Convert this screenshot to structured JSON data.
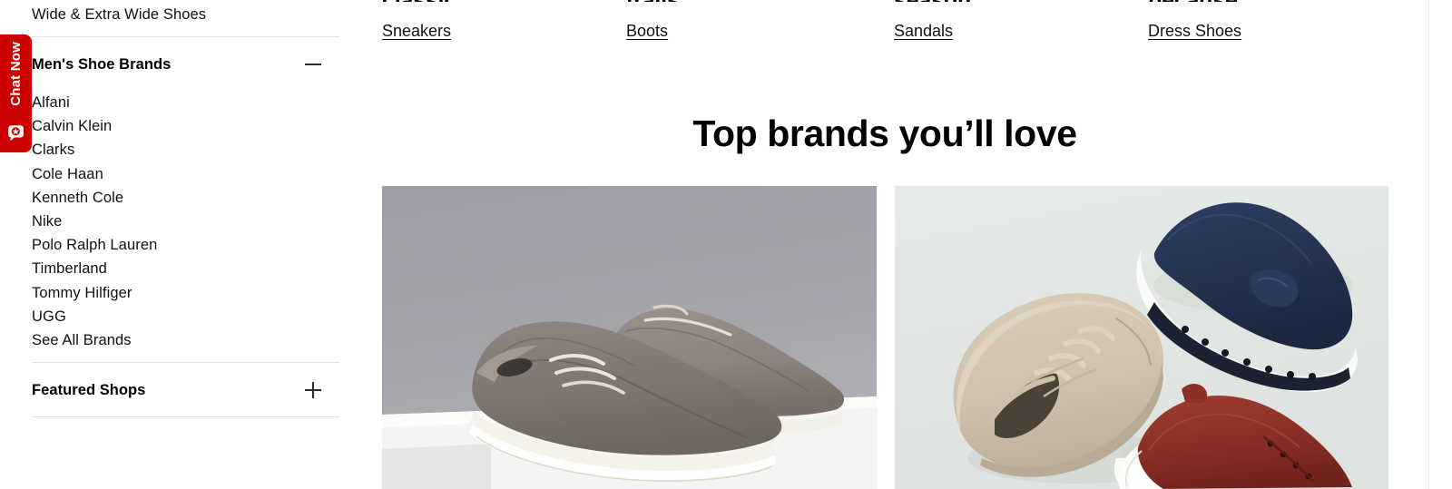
{
  "chat_widget": {
    "label": "Chat Now",
    "icon": "chat-bubble-icon",
    "color": "#cc0000"
  },
  "sidebar": {
    "top_link": "Wide & Extra Wide Shoes",
    "sections": [
      {
        "title": "Men's Shoe Brands",
        "toggle": "minus-icon",
        "expanded": true,
        "items": [
          "Alfani",
          "Calvin Klein",
          "Clarks",
          "Cole Haan",
          "Kenneth Cole",
          "Nike",
          "Polo Ralph Lauren",
          "Timberland",
          "Tommy Hilfiger",
          "UGG",
          "See All Brands"
        ]
      },
      {
        "title": "Featured Shops",
        "toggle": "plus-icon",
        "expanded": false,
        "items": []
      }
    ]
  },
  "promo": {
    "columns": [
      {
        "heading": "classic",
        "link": "Sneakers"
      },
      {
        "heading": "trails",
        "link": "Boots"
      },
      {
        "heading": "season",
        "link": "Sandals"
      },
      {
        "heading": "because",
        "link": "Dress Shoes"
      }
    ]
  },
  "main": {
    "brands_heading": "Top brands you’ll love",
    "tiles": [
      {
        "name": "gray-casual-shoes-tile",
        "alt": "Pair of gray textile moc-toe casual shoes on a white pedestal",
        "bg": "#a2a2a9"
      },
      {
        "name": "assorted-shoes-tile",
        "alt": "Beige suede sneaker, navy suede driving loafer and burgundy leather oxford",
        "bg": "#e3e7e3"
      }
    ]
  },
  "colors": {
    "brand_red": "#cc0000",
    "text": "#111111",
    "divider": "#e3e3e3",
    "tile_left_bg": "#a2a2a9",
    "tile_right_bg": "#e3e7e3"
  }
}
